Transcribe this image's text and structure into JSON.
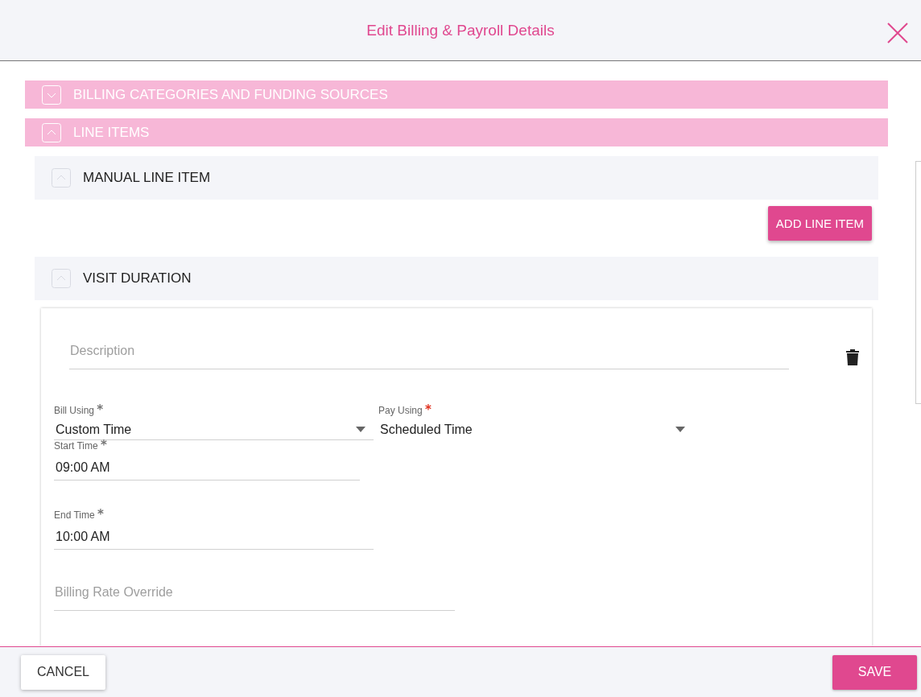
{
  "dialog": {
    "title": "Edit Billing & Payroll Details"
  },
  "sections": [
    {
      "title": "BILLING CATEGORIES AND FUNDING SOURCES",
      "expanded": false
    },
    {
      "title": "LINE ITEMS",
      "expanded": true
    }
  ],
  "subsections": [
    {
      "title": "MANUAL LINE ITEM",
      "expanded": true,
      "button": "ADD LINE ITEM"
    },
    {
      "title": "VISIT DURATION",
      "expanded": true
    }
  ],
  "form": {
    "description": {
      "placeholder": "Description"
    },
    "bill_using": {
      "label": "Bill Using",
      "mark": "*",
      "color": "#757575",
      "value": "Custom Time"
    },
    "pay_using": {
      "label": "Pay Using",
      "mark": "*",
      "color": "#e0301e",
      "value": "Scheduled Time"
    },
    "start_time": {
      "label": "Start Time",
      "mark": "*",
      "color": "#757575",
      "value": "09:00  AM"
    },
    "end_time": {
      "label": "End Time",
      "mark": "*",
      "color": "#757575",
      "value": "10:00  AM"
    },
    "billing_rate_override": {
      "placeholder": "Billing Rate Override"
    }
  },
  "footer": {
    "cancel": "CANCEL",
    "save": "SAVE"
  }
}
